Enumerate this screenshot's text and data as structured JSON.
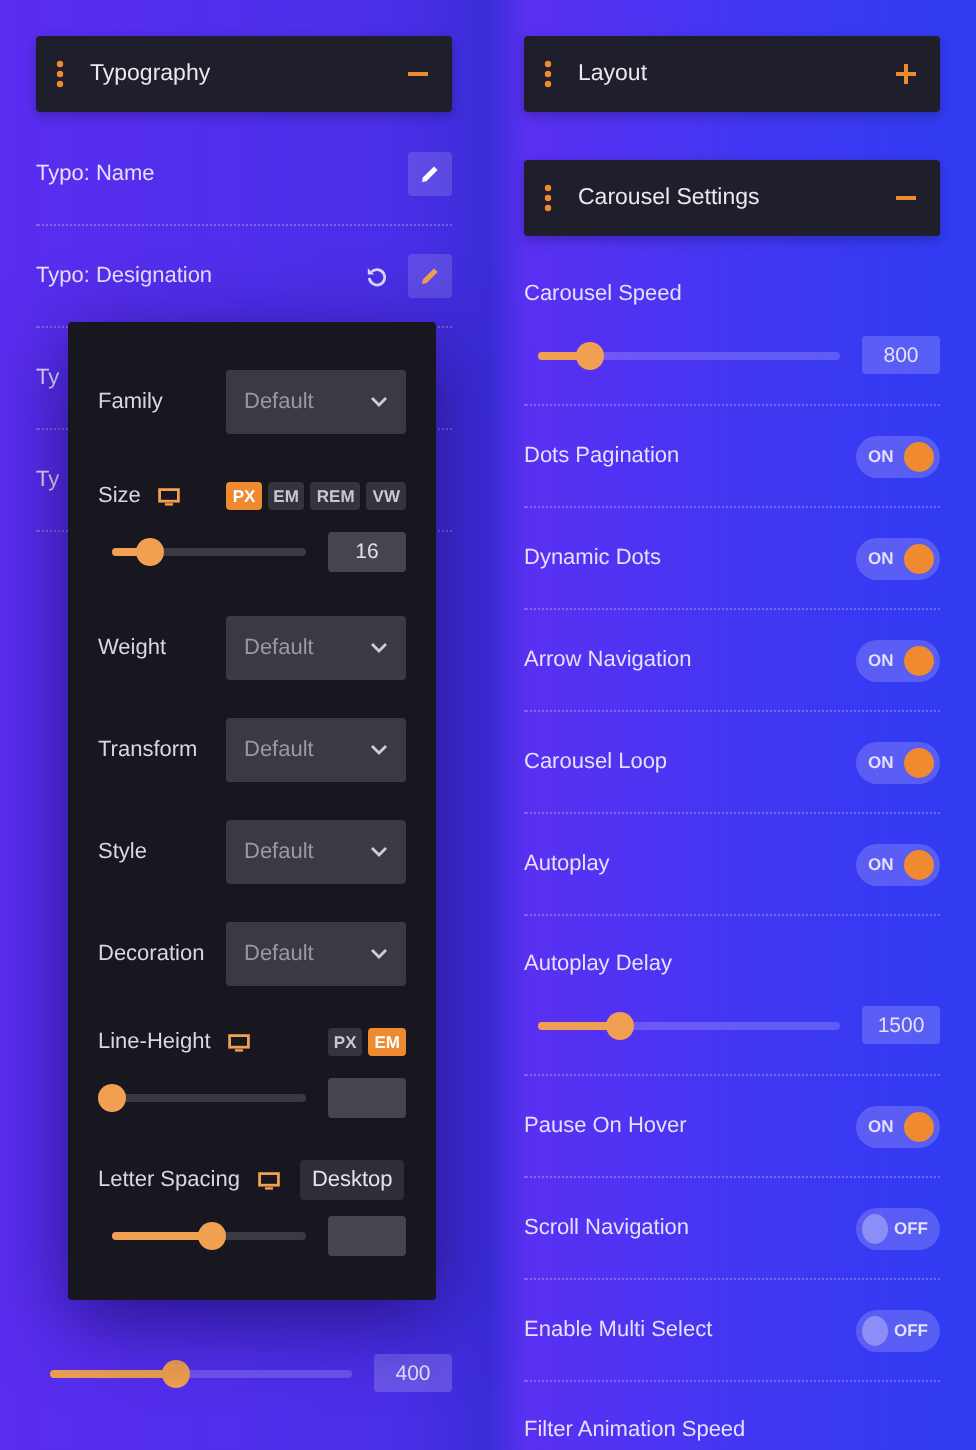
{
  "left_panel": {
    "section": {
      "title": "Typography",
      "expanded": true
    },
    "fields": [
      {
        "label": "Typo: Name",
        "reset": false,
        "editing": false
      },
      {
        "label": "Typo: Designation",
        "reset": true,
        "editing": true
      },
      {
        "label": "Ty"
      },
      {
        "label": "Ty"
      }
    ],
    "typography_popup": {
      "controls": [
        {
          "kind": "select",
          "label": "Family",
          "value": "Default"
        },
        {
          "kind": "slider",
          "label": "Size",
          "units": [
            {
              "label": "PX",
              "selected": true
            },
            {
              "label": "EM",
              "selected": false
            },
            {
              "label": "REM",
              "selected": false
            },
            {
              "label": "VW",
              "selected": false
            }
          ],
          "level": 0.2,
          "value": "16"
        },
        {
          "kind": "select",
          "label": "Weight",
          "value": "Default"
        },
        {
          "kind": "select",
          "label": "Transform",
          "value": "Default"
        },
        {
          "kind": "select",
          "label": "Style",
          "value": "Default"
        },
        {
          "kind": "select",
          "label": "Decoration",
          "value": "Default"
        },
        {
          "kind": "slider",
          "label": "Line-Height",
          "units": [
            {
              "label": "PX",
              "selected": false
            },
            {
              "label": "EM",
              "selected": true
            }
          ],
          "level": 0
        },
        {
          "kind": "slider",
          "label": "Letter Spacing",
          "tooltip": "Desktop",
          "level": 0.52
        }
      ]
    },
    "bottom_slider": {
      "level": 0.42,
      "value": "400"
    }
  },
  "right_panel": {
    "sections": [
      {
        "title": "Layout",
        "expanded": false
      },
      {
        "title": "Carousel Settings",
        "expanded": true
      }
    ],
    "settings": [
      {
        "kind": "slider",
        "label": "Carousel Speed",
        "level": 0.17,
        "value": "800"
      },
      {
        "kind": "toggle",
        "label": "Dots Pagination",
        "on": true,
        "switch_text": "ON"
      },
      {
        "kind": "toggle",
        "label": "Dynamic Dots",
        "on": true,
        "switch_text": "ON"
      },
      {
        "kind": "toggle",
        "label": "Arrow Navigation",
        "on": true,
        "switch_text": "ON"
      },
      {
        "kind": "toggle",
        "label": "Carousel Loop",
        "on": true,
        "switch_text": "ON"
      },
      {
        "kind": "toggle",
        "label": "Autoplay",
        "on": true,
        "switch_text": "ON"
      },
      {
        "kind": "slider",
        "label": "Autoplay Delay",
        "level": 0.27,
        "value": "1500"
      },
      {
        "kind": "toggle",
        "label": "Pause On Hover",
        "on": true,
        "switch_text": "ON"
      },
      {
        "kind": "toggle",
        "label": "Scroll Navigation",
        "on": false,
        "switch_text": "OFF"
      },
      {
        "kind": "toggle",
        "label": "Enable Multi Select",
        "on": false,
        "switch_text": "OFF"
      },
      {
        "kind": "label",
        "label": "Filter Animation Speed"
      }
    ]
  }
}
